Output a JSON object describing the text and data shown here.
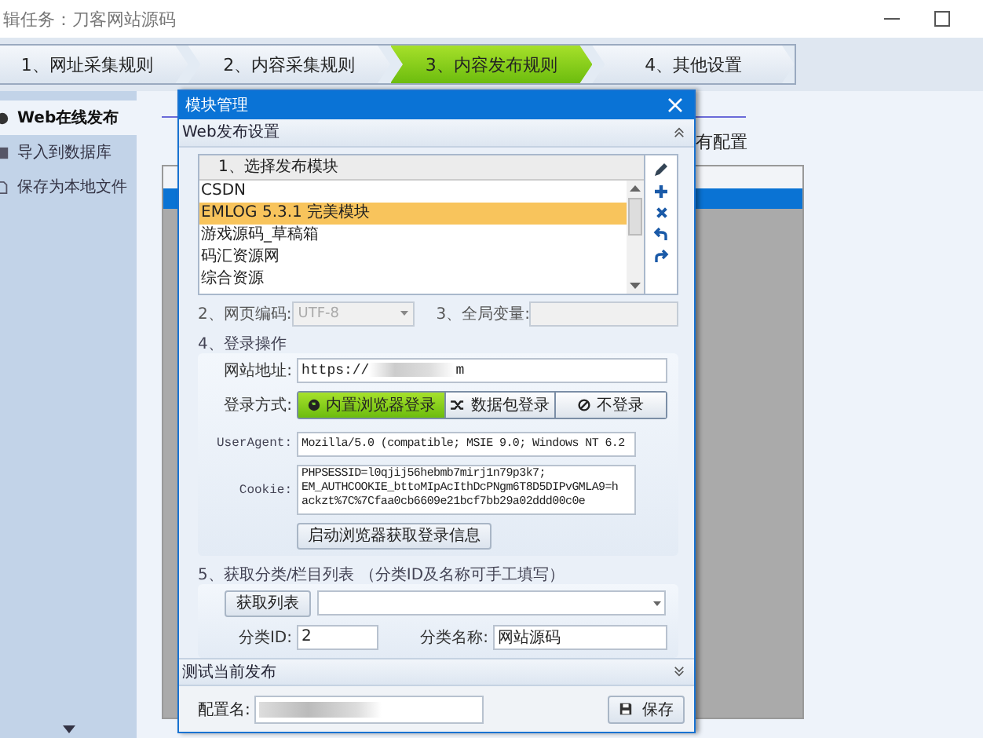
{
  "window": {
    "title": "辑任务：刀客网站源码"
  },
  "steps": [
    {
      "label": "1、网址采集规则",
      "selected": false
    },
    {
      "label": "2、内容采集规则",
      "selected": false
    },
    {
      "label": "3、内容发布规则",
      "selected": true
    },
    {
      "label": "4、其他设置",
      "selected": false
    }
  ],
  "sidebar": {
    "items": [
      {
        "label": "Web在线发布",
        "selected": true
      },
      {
        "label": "导入到数据库",
        "selected": false
      },
      {
        "label": "保存为本地文件",
        "selected": false
      }
    ]
  },
  "main": {
    "config_label": "有配置",
    "table": {
      "rows": [
        {
          "selected": true
        }
      ]
    }
  },
  "dialog": {
    "title": "模块管理",
    "settings_section": {
      "title": "Web发布设置",
      "expanded": true
    },
    "module_list": {
      "header": "1、选择发布模块",
      "items": [
        {
          "label": "CSDN",
          "selected": false
        },
        {
          "label": "EMLOG 5.3.1 完美模块",
          "selected": true
        },
        {
          "label": "游戏源码_草稿箱",
          "selected": false
        },
        {
          "label": "码汇资源网",
          "selected": false
        },
        {
          "label": "综合资源",
          "selected": false
        }
      ]
    },
    "encoding": {
      "label": "2、网页编码:",
      "value": "UTF-8",
      "disabled": true
    },
    "global_var": {
      "label": "3、全局变量:",
      "disabled": true
    },
    "login": {
      "title": "4、登录操作",
      "url_label": "网站地址:",
      "url_start": "https://",
      "url_end": "m",
      "method_label": "登录方式:",
      "methods": [
        {
          "label": "内置浏览器登录",
          "selected": true
        },
        {
          "label": "数据包登录",
          "selected": false
        },
        {
          "label": "不登录",
          "selected": false
        }
      ],
      "ua_label": "UserAgent:",
      "ua": "Mozilla/5.0 (compatible; MSIE 9.0; Windows NT 6.2",
      "cookie_label": "Cookie:",
      "cookie_lines": [
        "PHPSESSID=l0qjij56hebmb7mirj1n79p3k7;",
        "EM_AUTHCOOKIE_bttoMIpAcIthDcPNgm6T8D5DIPvGMLA9=h",
        "ackzt%7C%7Cfaa0cb6609e21bcf7bb29a02ddd00c0e"
      ],
      "fetch_button": "启动浏览器获取登录信息"
    },
    "category": {
      "title": "5、获取分类/栏目列表 （分类ID及名称可手工填写）",
      "fetch_button": "获取列表",
      "id_label": "分类ID:",
      "id": "2",
      "name_label": "分类名称:",
      "name": "网站源码"
    },
    "test_section": {
      "title": "测试当前发布",
      "expanded": false
    },
    "config_label": "配置名:",
    "save_button": "保存"
  }
}
